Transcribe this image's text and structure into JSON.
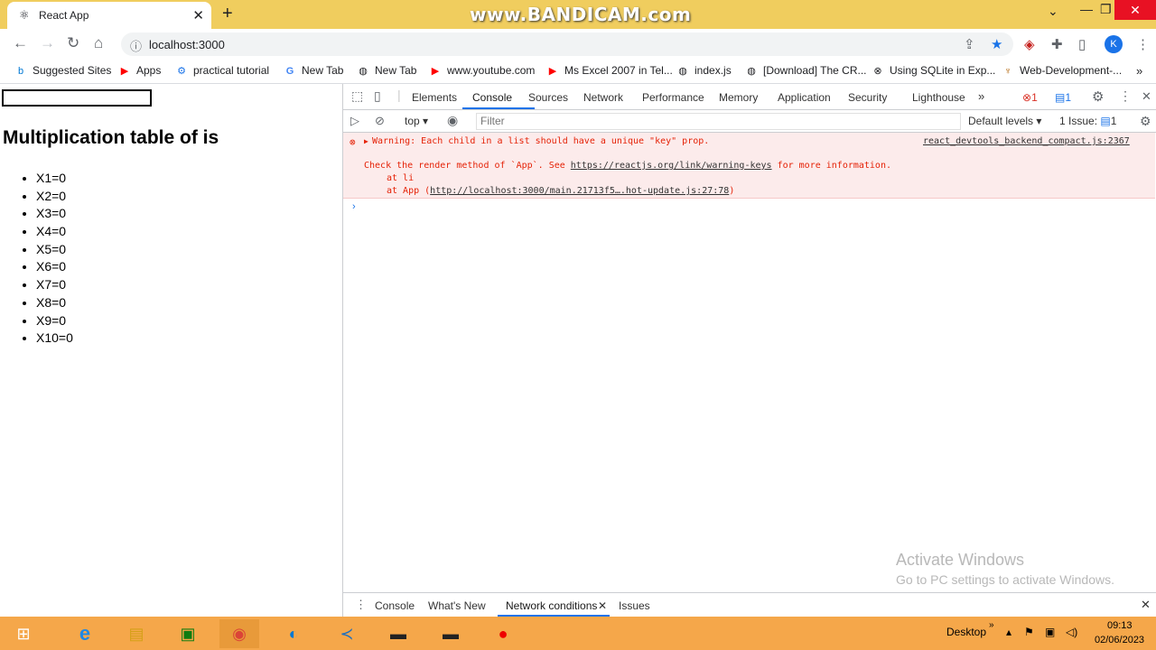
{
  "browser": {
    "tab_title": "React App",
    "watermark": "www.BANDICAM.com",
    "url": "localhost:3000",
    "avatar_letter": "K"
  },
  "bookmarks": [
    {
      "label": "Suggested Sites",
      "icon": "bing-icon"
    },
    {
      "label": "Apps",
      "icon": "youtube-icon"
    },
    {
      "label": "practical tutorial",
      "icon": "gear-icon"
    },
    {
      "label": "New Tab",
      "icon": "google-icon"
    },
    {
      "label": "New Tab",
      "icon": "globe-icon"
    },
    {
      "label": "www.youtube.com",
      "icon": "youtube-icon"
    },
    {
      "label": "Ms Excel 2007 in Tel...",
      "icon": "youtube-icon"
    },
    {
      "label": "index.js",
      "icon": "globe-icon"
    },
    {
      "label": "[Download] The CR...",
      "icon": "globe-icon"
    },
    {
      "label": "Using SQLite in Exp...",
      "icon": "x-icon"
    },
    {
      "label": "Web-Development-...",
      "icon": "site-icon"
    }
  ],
  "page": {
    "heading": "Multiplication table of is",
    "rows": [
      "X1=0",
      "X2=0",
      "X3=0",
      "X4=0",
      "X5=0",
      "X6=0",
      "X7=0",
      "X8=0",
      "X9=0",
      "X10=0"
    ]
  },
  "devtools": {
    "tabs": [
      "Elements",
      "Console",
      "Sources",
      "Network",
      "Performance",
      "Memory",
      "Application",
      "Security",
      "Lighthouse"
    ],
    "active_tab": "Console",
    "error_count": "1",
    "message_count": "1",
    "context": "top",
    "filter_placeholder": "Filter",
    "levels": "Default levels",
    "issues": "1 Issue:",
    "issues_count": "1",
    "warning": {
      "text": "Warning: Each child in a list should have a unique \"key\" prop.",
      "source": "react_devtools_backend_compact.js:2367",
      "line2_pre": "Check the render method of `App`. See ",
      "line2_link": "https://reactjs.org/link/warning-keys",
      "line2_post": " for more information.",
      "line3": "at li",
      "line4_pre": "at App (",
      "line4_link": "http://localhost:3000/main.21713f5….hot-update.js:27:78",
      "line4_post": ")"
    },
    "prompt": "›",
    "drawer_tabs": [
      "Console",
      "What's New",
      "Network conditions",
      "Issues"
    ]
  },
  "watermark": {
    "line1": "Activate Windows",
    "line2": "Go to PC settings to activate Windows."
  },
  "taskbar": {
    "desktop_label": "Desktop",
    "time": "09:13",
    "date": "02/06/2023"
  }
}
